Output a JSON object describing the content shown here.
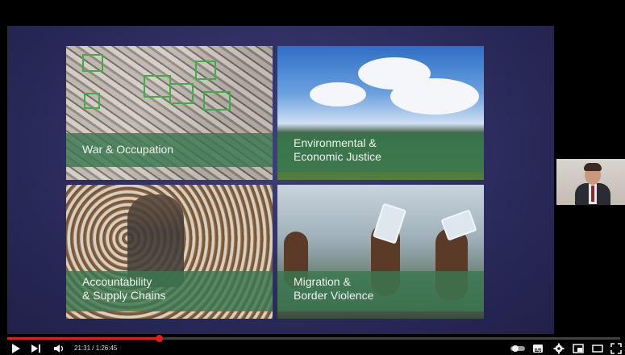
{
  "slide": {
    "tiles": [
      {
        "label": "War & Occupation"
      },
      {
        "label_line1": "Environmental &",
        "label_line2": "Economic Justice"
      },
      {
        "label_line1": "Accountability",
        "label_line2": "& Supply Chains"
      },
      {
        "label_line1": "Migration &",
        "label_line2": "Border Violence"
      }
    ]
  },
  "player": {
    "time": "21:31 / 1:26:45",
    "progress_fraction": 0.248,
    "controls": {
      "play_icon": "play-icon",
      "next_icon": "next-icon",
      "volume_icon": "volume-icon",
      "autoplay_icon": "autoplay-toggle-icon",
      "subtitles_icon": "subtitles-icon",
      "settings_icon": "gear-icon",
      "miniplayer_icon": "miniplayer-icon",
      "theater_icon": "theater-icon",
      "fullscreen_icon": "fullscreen-icon"
    }
  }
}
